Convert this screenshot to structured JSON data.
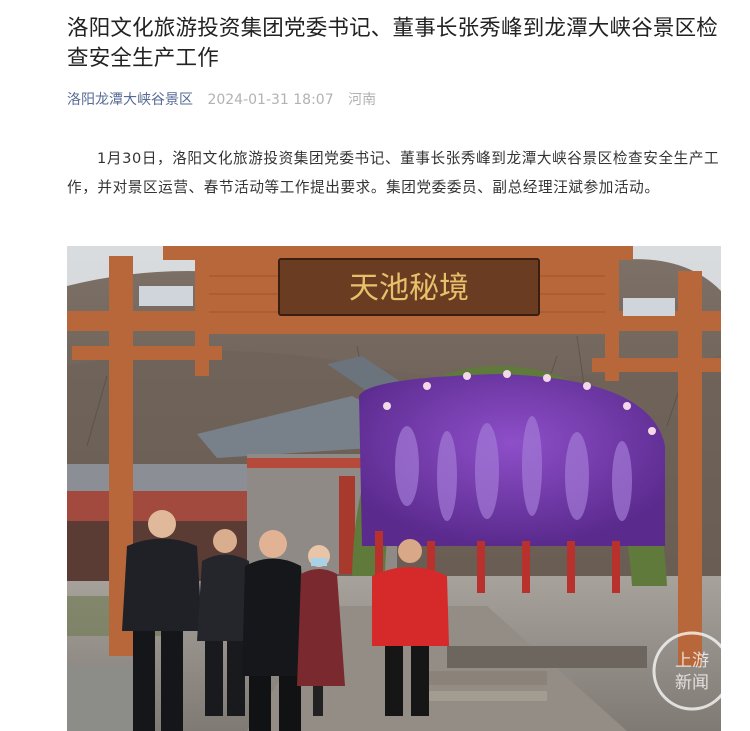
{
  "article": {
    "title": "洛阳文化旅游投资集团党委书记、董事长张秀峰到龙潭大峡谷景区检查安全生产工作",
    "account_name": "洛阳龙潭大峡谷景区",
    "publish_time": "2024-01-31 18:07",
    "location": "河南",
    "paragraph": "1月30日，洛阳文化旅游投资集团党委书记、董事长张秀峰到龙潭大峡谷景区检查安全生产工作，并对景区运营、春节活动等工作提出要求。集团党委委员、副总经理汪斌参加活动。"
  },
  "photo": {
    "gate_sign_text": "天池秘境",
    "watermark_line1": "上游",
    "watermark_line2": "新闻"
  }
}
